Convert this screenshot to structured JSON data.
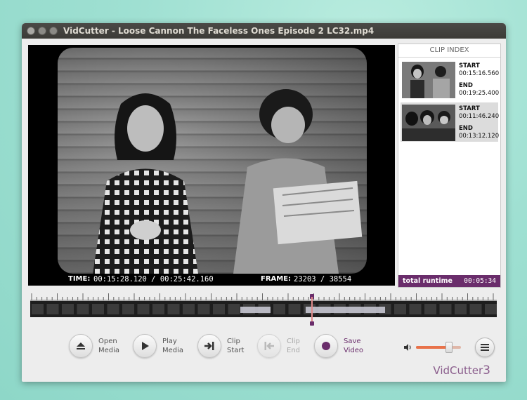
{
  "window": {
    "title": "VidCutter - Loose Cannon The Faceless Ones Episode 2 LC32.mp4"
  },
  "video": {
    "time_label": "TIME:",
    "time_value": "00:15:28.120 / 00:25:42.160",
    "frame_label": "FRAME:",
    "frame_value": "23203 / 38554"
  },
  "clip_index": {
    "header": "CLIP INDEX",
    "items": [
      {
        "start_label": "START",
        "start": "00:15:16.560",
        "end_label": "END",
        "end": "00:19:25.400"
      },
      {
        "start_label": "START",
        "start": "00:11:46.240",
        "end_label": "END",
        "end": "00:13:12.120"
      }
    ],
    "total_label": "total runtime",
    "total_value": "00:05:34"
  },
  "timeline": {
    "position": 0.604,
    "clips": [
      [
        0.45,
        0.515
      ],
      [
        0.59,
        0.76
      ]
    ]
  },
  "controls": {
    "open": [
      "Open",
      "Media"
    ],
    "play": [
      "Play",
      "Media"
    ],
    "clip_start": [
      "Clip",
      "Start"
    ],
    "clip_end": [
      "Clip",
      "End"
    ],
    "save": [
      "Save",
      "Video"
    ]
  },
  "volume": {
    "level": 0.72
  },
  "brand": {
    "name": "VidCutter",
    "version": "3"
  },
  "colors": {
    "accent": "#6a2d6b",
    "volume": "#e8724a"
  },
  "icons": [
    "eject-icon",
    "play-icon",
    "clip-start-icon",
    "clip-end-icon",
    "record-icon",
    "volume-icon",
    "menu-icon"
  ]
}
